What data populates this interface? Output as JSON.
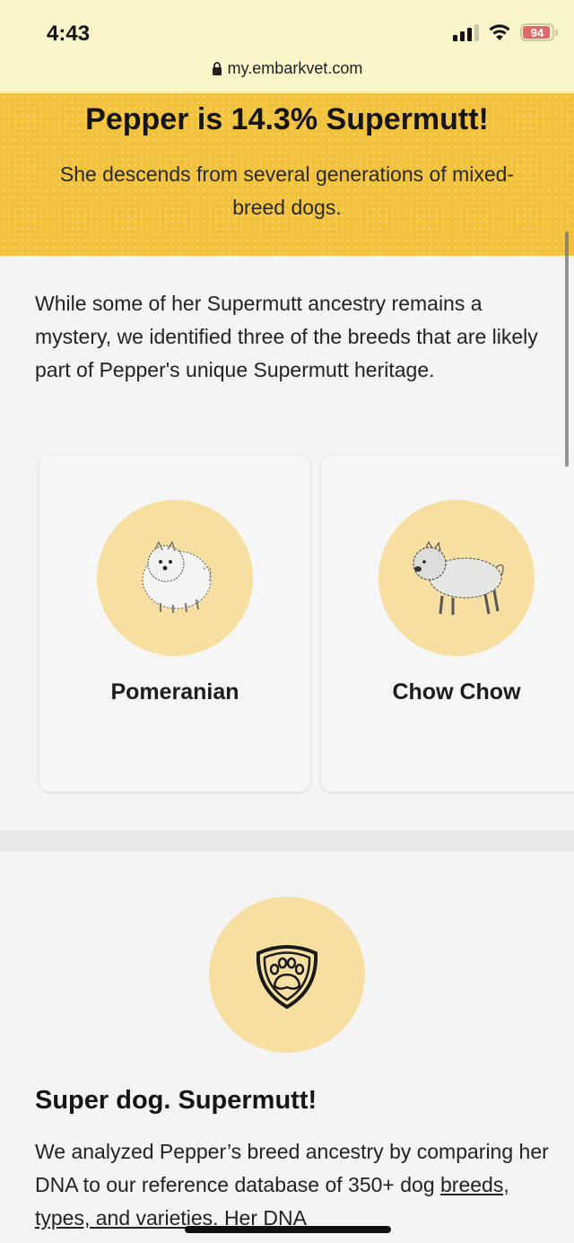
{
  "status_bar": {
    "time": "4:43",
    "battery": "94"
  },
  "browser": {
    "url": "my.embarkvet.com"
  },
  "hero": {
    "title": "Pepper is 14.3% Supermutt!",
    "subtitle": "She descends from several generations of mixed-breed dogs."
  },
  "intro": "While some of her Supermutt ancestry remains a mystery, we identified three of the breeds that are likely part of Pepper's unique Supermutt heritage.",
  "breeds": [
    {
      "name": "Pomeranian",
      "icon": "pomeranian-illustration"
    },
    {
      "name": "Chow Chow",
      "icon": "chow-chow-illustration"
    }
  ],
  "supermutt": {
    "icon": "paw-shield-icon",
    "title": "Super dog. Supermutt!",
    "body_start": "We analyzed Pepper’s breed ancestry by comparing her DNA to our reference database of 350+ dog ",
    "body_link": "breeds, types, and varieties",
    "body_end": ". Her DNA"
  },
  "colors": {
    "hero_bg": "#f2c23c",
    "circle_bg": "#f6dfa1",
    "topbar_bg": "#fbf6c9",
    "page_bg": "#f4f4f4"
  }
}
